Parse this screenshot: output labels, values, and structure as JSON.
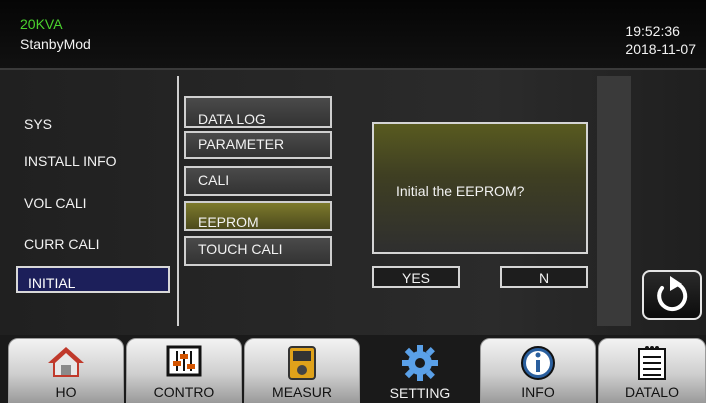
{
  "header": {
    "model": "20KVA",
    "mode": "StanbyMod",
    "time": "19:52:36",
    "date": "2018-11-07"
  },
  "left_menu": {
    "items": [
      "SYS",
      "INSTALL INFO",
      "VOL CALI",
      "CURR CALI",
      "INITIAL"
    ],
    "selected": "INITIAL"
  },
  "sub_menu": {
    "items": [
      "DATA LOG",
      "PARAMETER",
      "CALI",
      "EEPROM",
      "TOUCH CALI"
    ],
    "selected": "EEPROM"
  },
  "dialog": {
    "message": "Initial the EEPROM?",
    "yes_label": "YES",
    "no_label": "N"
  },
  "nav": {
    "tabs": [
      "HO",
      "CONTRO",
      "MEASUR",
      "SETTING",
      "INFO",
      "DATALO"
    ],
    "selected": "SETTING"
  },
  "colors": {
    "model_text": "#4bd22e",
    "selected_left": "#1c1f5a",
    "selected_sub": "#7d7a2c",
    "dialog_top": "#585a20"
  }
}
